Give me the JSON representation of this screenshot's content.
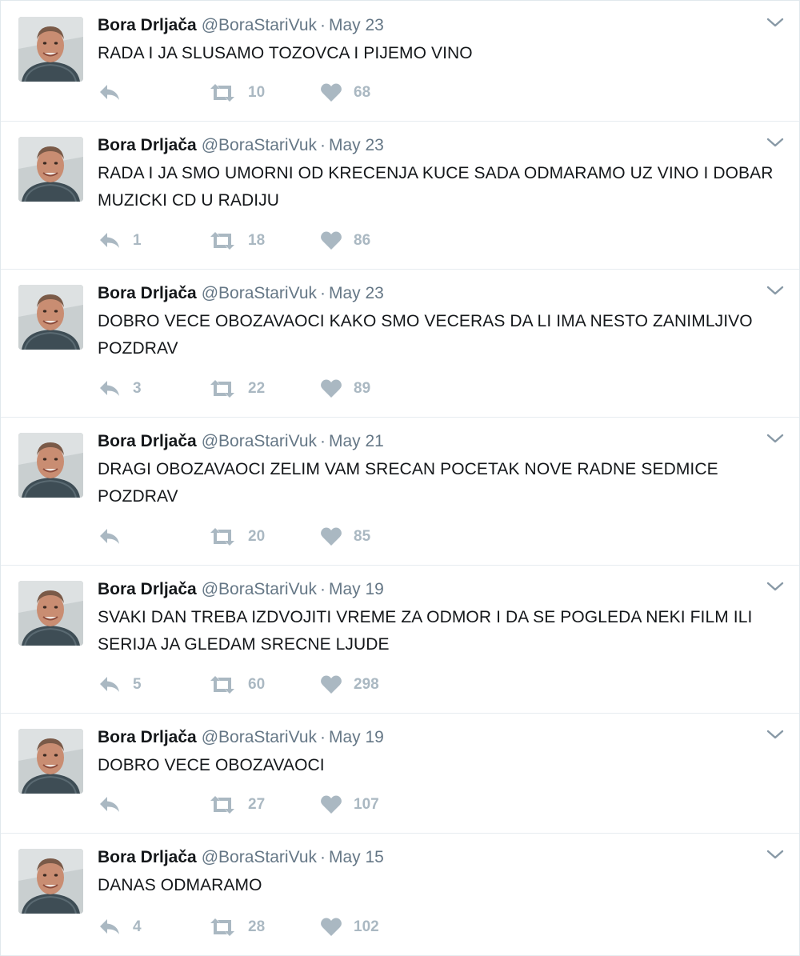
{
  "feed": {
    "tweets": [
      {
        "name": "Bora Drljača",
        "handle": "@BoraStariVuk",
        "dot": "·",
        "date": "May 23",
        "text": "RADA I JA SLUSAMO TOZOVCA I PIJEMO VINO",
        "replies": "",
        "retweets": "10",
        "likes": "68"
      },
      {
        "name": "Bora Drljača",
        "handle": "@BoraStariVuk",
        "dot": "·",
        "date": "May 23",
        "text": "RADA I JA SMO UMORNI OD KRECENJA KUCE SADA ODMARAMO UZ VINO I DOBAR MUZICKI CD U RADIJU",
        "replies": "1",
        "retweets": "18",
        "likes": "86"
      },
      {
        "name": "Bora Drljača",
        "handle": "@BoraStariVuk",
        "dot": "·",
        "date": "May 23",
        "text": "DOBRO VECE OBOZAVAOCI KAKO SMO VECERAS DA LI IMA NESTO ZANIMLJIVO POZDRAV",
        "replies": "3",
        "retweets": "22",
        "likes": "89"
      },
      {
        "name": "Bora Drljača",
        "handle": "@BoraStariVuk",
        "dot": "·",
        "date": "May 21",
        "text": "DRAGI OBOZAVAOCI ZELIM VAM SRECAN POCETAK NOVE RADNE SEDMICE POZDRAV",
        "replies": "",
        "retweets": "20",
        "likes": "85"
      },
      {
        "name": "Bora Drljača",
        "handle": "@BoraStariVuk",
        "dot": "·",
        "date": "May 19",
        "text": "SVAKI DAN TREBA IZDVOJITI VREME ZA ODMOR I DA SE POGLEDA NEKI FILM ILI SERIJA JA GLEDAM SRECNE LJUDE",
        "replies": "5",
        "retweets": "60",
        "likes": "298"
      },
      {
        "name": "Bora Drljača",
        "handle": "@BoraStariVuk",
        "dot": "·",
        "date": "May 19",
        "text": "DOBRO VECE OBOZAVAOCI",
        "replies": "",
        "retweets": "27",
        "likes": "107"
      },
      {
        "name": "Bora Drljača",
        "handle": "@BoraStariVuk",
        "dot": "·",
        "date": "May 15",
        "text": "DANAS ODMARAMO",
        "replies": "4",
        "retweets": "28",
        "likes": "102"
      }
    ],
    "icons": {
      "avatar": "profile-photo",
      "caret": "chevron-down-icon",
      "reply": "reply-icon",
      "retweet": "retweet-icon",
      "like": "heart-icon"
    },
    "colors": {
      "text": "#14171a",
      "secondary": "#657786",
      "icon": "#aab8c2",
      "divider": "#e6ecf0"
    }
  }
}
